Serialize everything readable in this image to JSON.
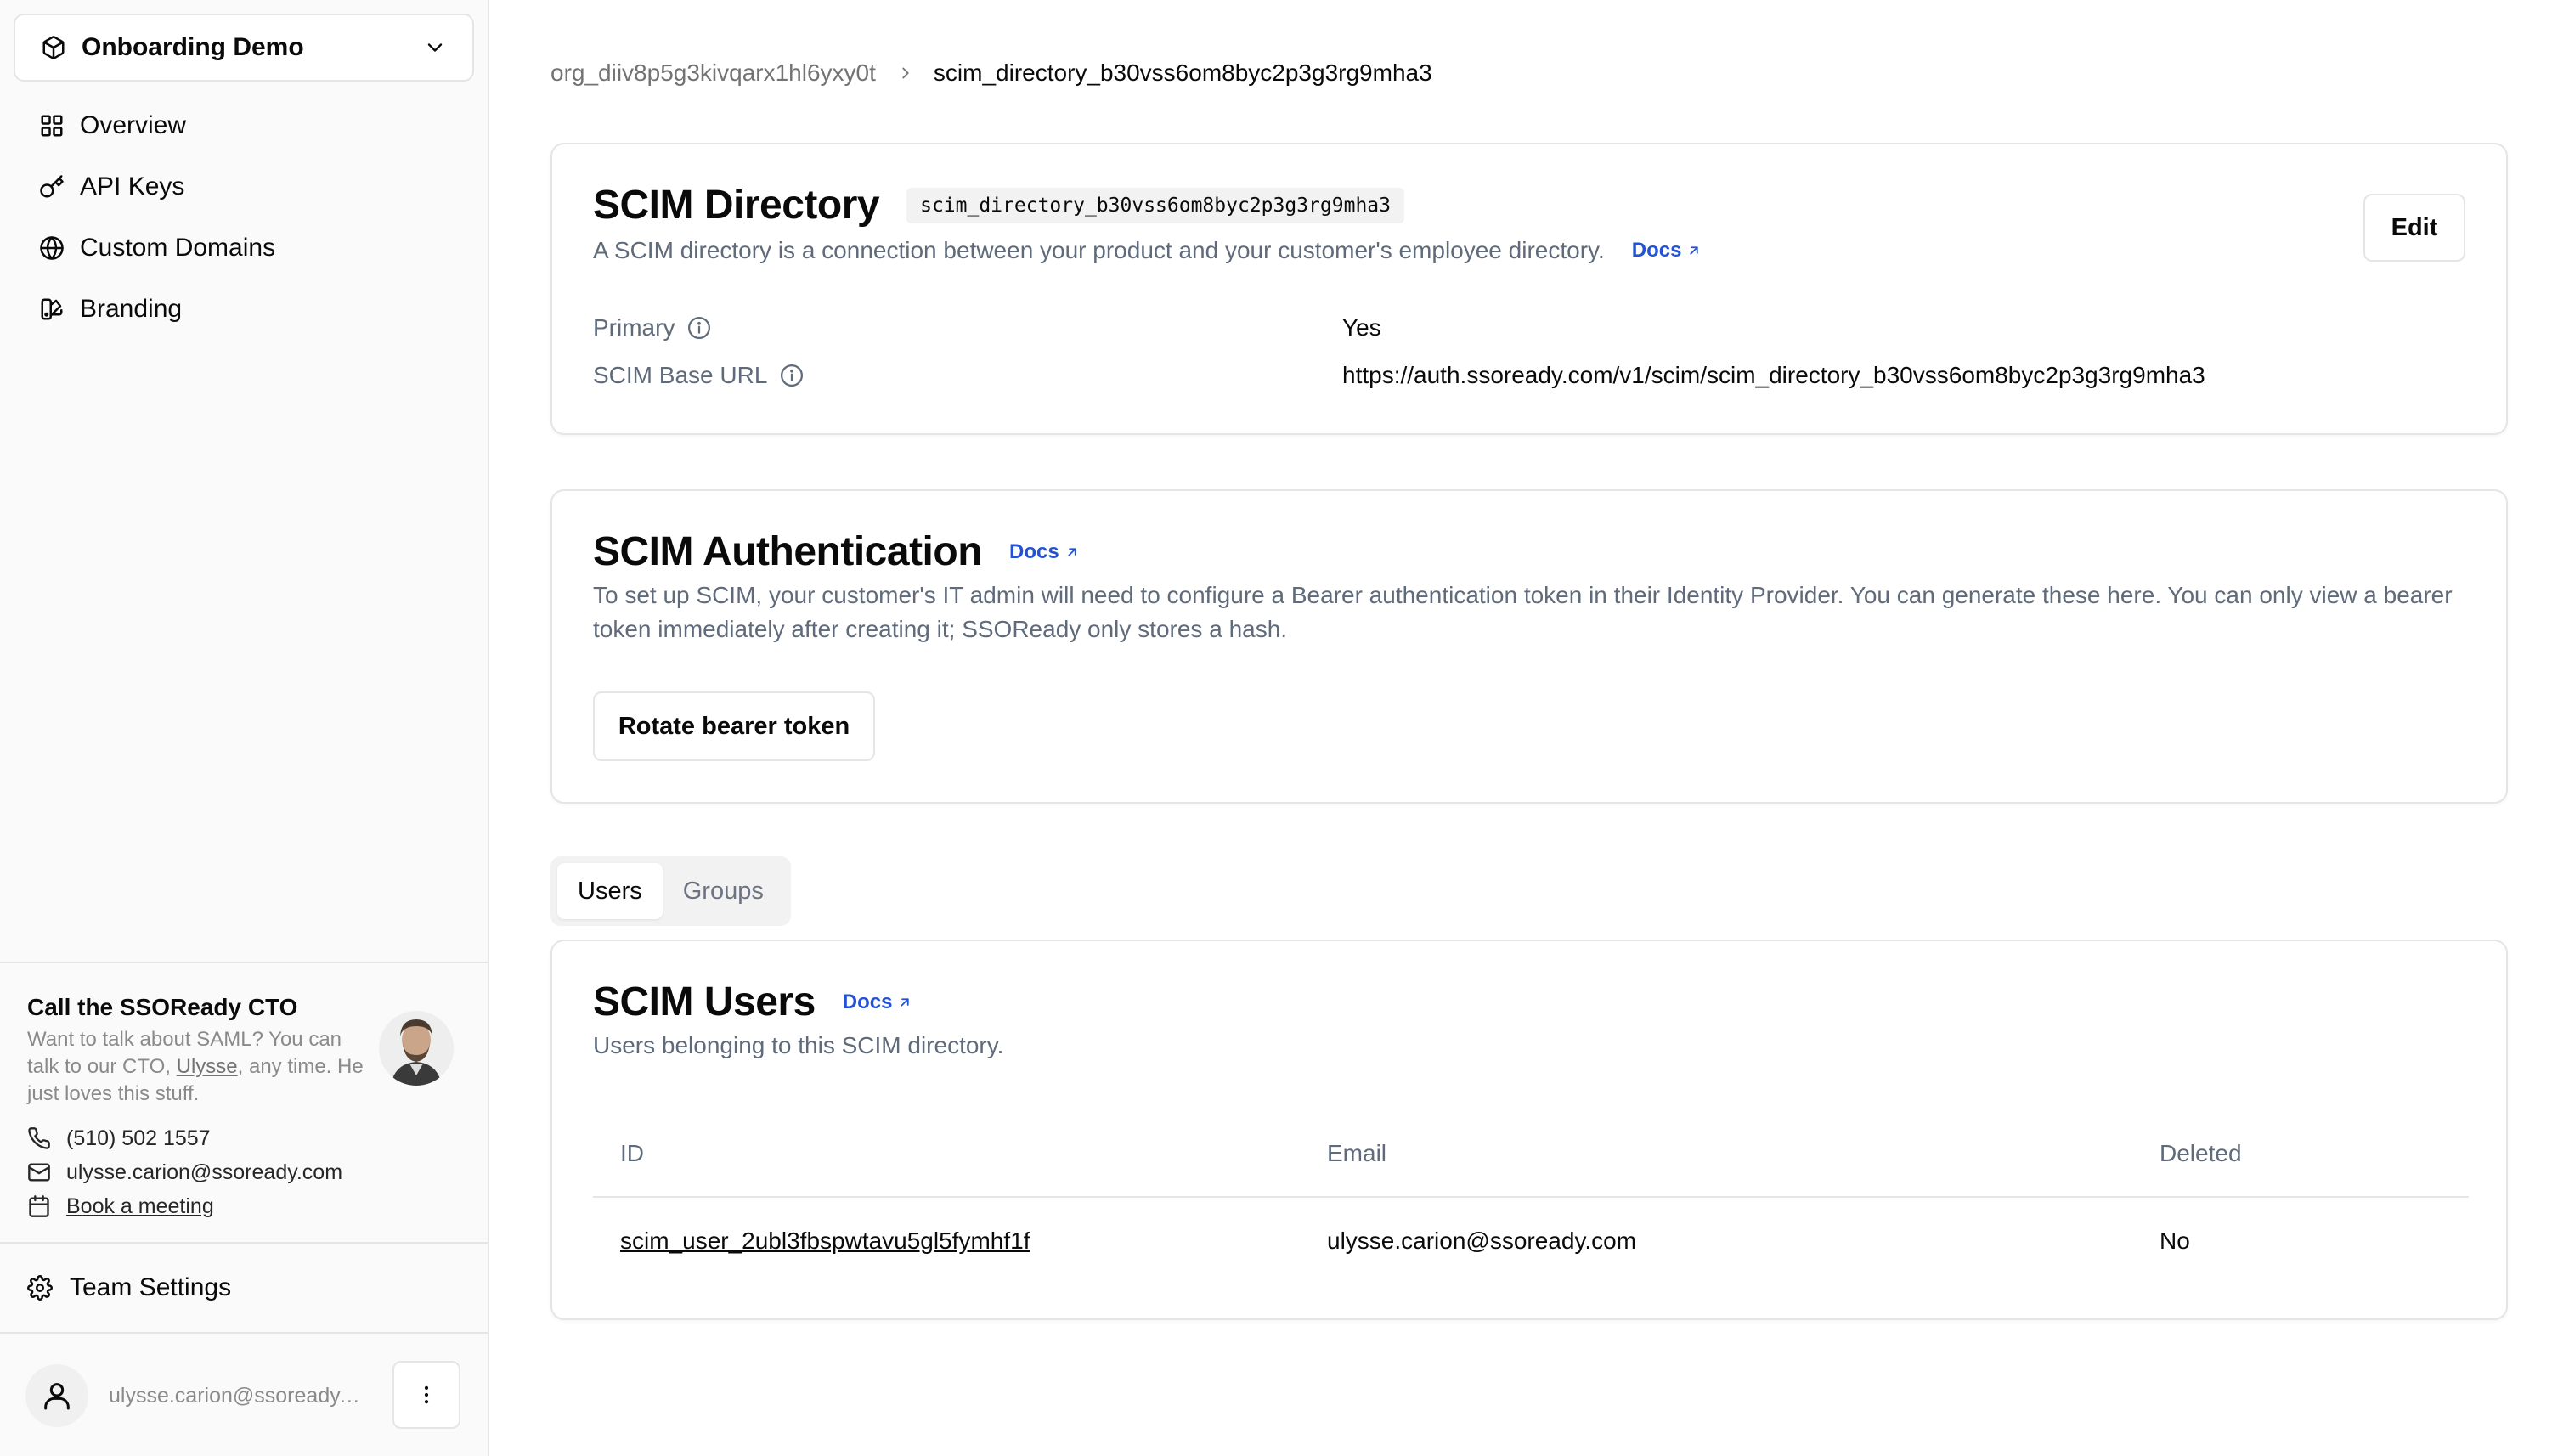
{
  "sidebar": {
    "org_switcher": {
      "name": "Onboarding Demo",
      "icon": "box-icon"
    },
    "nav": [
      {
        "label": "Overview",
        "icon": "grid-icon"
      },
      {
        "label": "API Keys",
        "icon": "key-icon"
      },
      {
        "label": "Custom Domains",
        "icon": "globe-icon"
      },
      {
        "label": "Branding",
        "icon": "palette-icon"
      }
    ],
    "cto_card": {
      "title": "Call the SSOReady CTO",
      "desc_before": "Want to talk about SAML? You can talk to our CTO, ",
      "desc_link": "Ulysse",
      "desc_after": ", any time. He just loves this stuff.",
      "phone": "(510) 502 1557",
      "email": "ulysse.carion@ssoready.com",
      "meeting": "Book a meeting"
    },
    "team_settings": "Team Settings",
    "user_email": "ulysse.carion@ssoready.com"
  },
  "breadcrumb": {
    "org": "org_diiv8p5g3kivqarx1hl6yxy0t",
    "current": "scim_directory_b30vss6om8byc2p3g3rg9mha3"
  },
  "directory_card": {
    "title": "SCIM Directory",
    "badge": "scim_directory_b30vss6om8byc2p3g3rg9mha3",
    "description": "A SCIM directory is a connection between your product and your customer's employee directory.",
    "docs": "Docs",
    "edit": "Edit",
    "rows": [
      {
        "label": "Primary",
        "value": "Yes"
      },
      {
        "label": "SCIM Base URL",
        "value": "https://auth.ssoready.com/v1/scim/scim_directory_b30vss6om8byc2p3g3rg9mha3"
      }
    ]
  },
  "auth_card": {
    "title": "SCIM Authentication",
    "docs": "Docs",
    "description": "To set up SCIM, your customer's IT admin will need to configure a Bearer authentication token in their Identity Provider. You can generate these here. You can only view a bearer token immediately after creating it; SSOReady only stores a hash.",
    "rotate": "Rotate bearer token"
  },
  "tabs": {
    "users": "Users",
    "groups": "Groups",
    "active": "Users"
  },
  "users_card": {
    "title": "SCIM Users",
    "docs": "Docs",
    "description": "Users belonging to this SCIM directory.",
    "columns": [
      "ID",
      "Email",
      "Deleted"
    ],
    "rows": [
      {
        "id": "scim_user_2ubl3fbspwtavu5gl5fymhf1f",
        "email": "ulysse.carion@ssoready.com",
        "deleted": "No"
      }
    ]
  },
  "colors": {
    "accent": "#2352d6",
    "muted": "#5f6a7a",
    "border": "#e5e5e5"
  }
}
